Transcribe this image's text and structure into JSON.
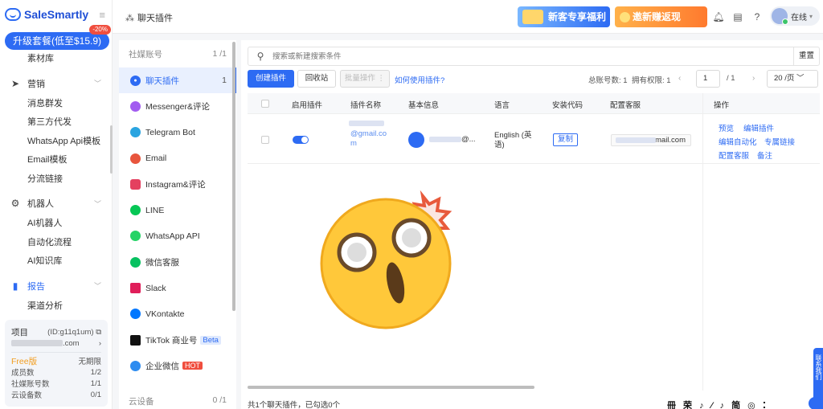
{
  "brand": {
    "name": "SaleSmartly"
  },
  "upgrade": {
    "label": "升级套餐(低至$15.9)",
    "discount": "-20%"
  },
  "sidebar": {
    "material": "素材库",
    "marketing": {
      "label": "营销",
      "items": [
        "消息群发",
        "第三方代发",
        "WhatsApp Api模板",
        "Email模板",
        "分流链接"
      ]
    },
    "robot": {
      "label": "机器人",
      "items": [
        "AI机器人",
        "自动化流程",
        "AI知识库"
      ]
    },
    "report": {
      "label": "报告",
      "items": [
        "渠道分析"
      ]
    }
  },
  "project": {
    "label": "项目",
    "id": "(ID:g11q1um)",
    "domain_suffix": ".com",
    "plan": "Free版",
    "expiry": "无期限",
    "members_label": "成员数",
    "members": "1/2",
    "social_label": "社媒账号数",
    "social": "1/1",
    "cloud_label": "云设备数",
    "cloud": "0/1"
  },
  "topbar": {
    "title": "聊天插件",
    "banner_new": "新客专享福利",
    "banner_invite": "邀新赚返现",
    "status": "在线"
  },
  "channels": {
    "header": "社媒账号",
    "header_count": "1 /1",
    "items": [
      {
        "label": "聊天插件",
        "count": "1",
        "color": "#2d6bf3"
      },
      {
        "label": "Messenger&评论",
        "color": "#a25cf0"
      },
      {
        "label": "Telegram Bot",
        "color": "#2aa4e0"
      },
      {
        "label": "Email",
        "color": "#e8553d"
      },
      {
        "label": "Instagram&评论",
        "color": "#e4405f"
      },
      {
        "label": "LINE",
        "color": "#06c755"
      },
      {
        "label": "WhatsApp API",
        "color": "#25d366"
      },
      {
        "label": "微信客服",
        "color": "#07c160"
      },
      {
        "label": "Slack",
        "color": "#e01e5a"
      },
      {
        "label": "VKontakte",
        "color": "#0077ff"
      },
      {
        "label": "TikTok 商业号",
        "badge": "Beta",
        "color": "#111111"
      },
      {
        "label": "企业微信",
        "badge": "HOT",
        "color": "#2d8cf0"
      }
    ],
    "footer": "云设备",
    "footer_count": "0 /1"
  },
  "main": {
    "search_placeholder": "搜索或新建搜索条件",
    "reset": "重置",
    "btn_create": "创建插件",
    "btn_recycle": "回收站",
    "btn_batch": "批量操作 ⋮",
    "help_link": "如何使用插件?",
    "total": "总账号数: 1",
    "permission": "拥有权限: 1",
    "page_current": "1",
    "page_total": "/ 1",
    "page_size": "20 /页",
    "columns": [
      "启用插件",
      "插件名称",
      "基本信息",
      "语言",
      "安装代码",
      "配置客服",
      "操作"
    ],
    "row": {
      "name_line1": "@gmail.co",
      "name_line2": "m",
      "info": "@...",
      "language_line1": "English (英",
      "language_line2": "语)",
      "copy": "复制",
      "agent_email": "mail.com"
    },
    "operations": [
      "预览",
      "编辑插件",
      "编辑自动化",
      "专属链接",
      "配置客服",
      "备注"
    ],
    "footer": "共1个聊天插件，已勾选0个",
    "footer_right": "冊 荣 ♪ ⁄ ♪ 简 ◎ ⁚"
  },
  "side_tab": "联系我们"
}
